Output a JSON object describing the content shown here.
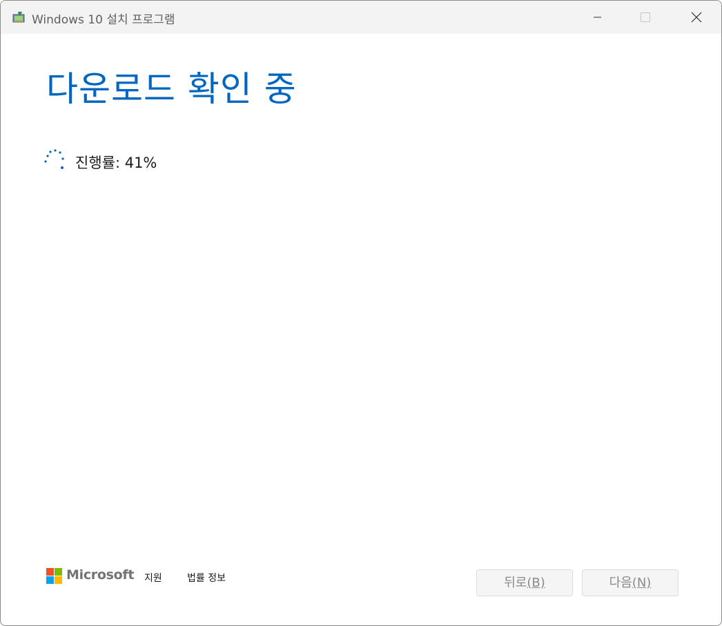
{
  "window": {
    "title": "Windows 10 설치 프로그램"
  },
  "main": {
    "heading": "다운로드 확인 중",
    "progress_label": "진행률: 41%",
    "progress_percent": 41
  },
  "footer": {
    "brand": "Microsoft",
    "support_link": "지원",
    "legal_link": "법률 정보",
    "back_button": {
      "label": "뒤로",
      "accel": "(B)"
    },
    "next_button": {
      "label": "다음",
      "accel": "(N)"
    }
  },
  "colors": {
    "accent": "#0067c0",
    "ms_red": "#f25022",
    "ms_green": "#7fba00",
    "ms_blue": "#00a4ef",
    "ms_yellow": "#ffb900"
  },
  "icons": {
    "app": "setup-app-icon",
    "minimize": "minimize-icon",
    "maximize": "maximize-icon",
    "close": "close-icon",
    "spinner": "loading-spinner-icon",
    "logo": "microsoft-logo"
  }
}
